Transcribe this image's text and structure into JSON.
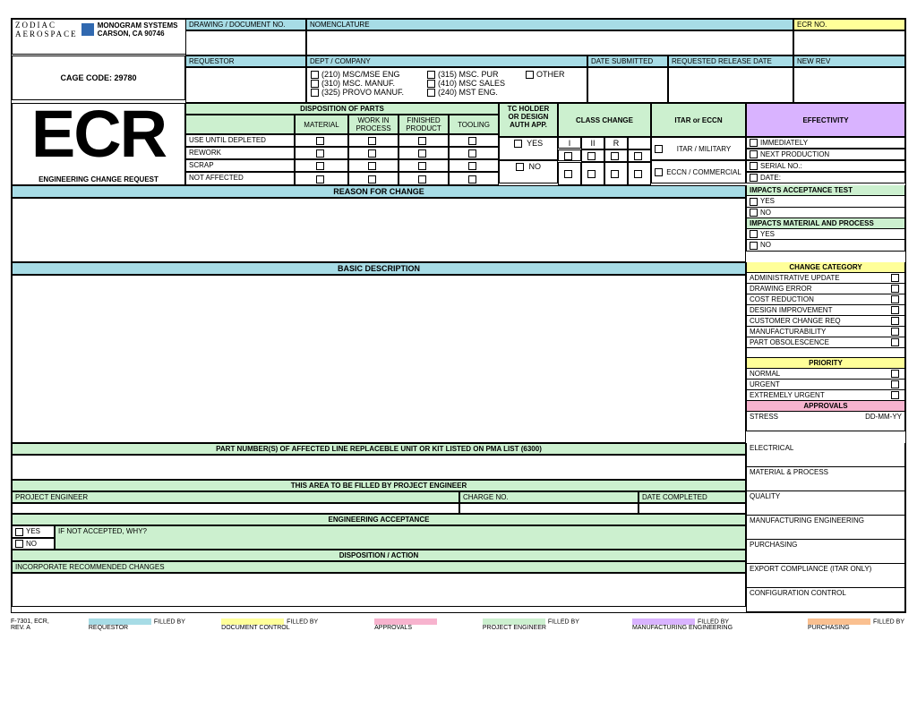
{
  "header": {
    "company_name": "MONOGRAM SYSTEMS",
    "company_city": "CARSON, CA 90746",
    "cage_label": "CAGE CODE:",
    "cage_code": "29780",
    "drawing_doc_label": "DRAWING / DOCUMENT NO.",
    "nomenclature_label": "NOMENCLATURE",
    "ecr_no_label": "ECR NO.",
    "requestor_label": "REQUESTOR",
    "dept_company_label": "DEPT / COMPANY",
    "date_submitted_label": "DATE SUBMITTED",
    "requested_release_label": "REQUESTED RELEASE DATE",
    "new_rev_label": "NEW REV",
    "departments": [
      "(210) MSC/MSE ENG",
      "(315) MSC. PUR",
      "OTHER",
      "(310) MSC. MANUF.",
      "(410) MSC SALES",
      "(325) PROVO MANUF.",
      "(240) MST ENG."
    ]
  },
  "ecr": {
    "title": "ECR",
    "subtitle": "ENGINEERING CHANGE REQUEST"
  },
  "disposition": {
    "section_label": "DISPOSITION OF PARTS",
    "cols": [
      "MATERIAL",
      "WORK IN PROCESS",
      "FINISHED PRODUCT",
      "TOOLING"
    ],
    "rows": [
      "USE UNTIL DEPLETED",
      "REWORK",
      "SCRAP",
      "NOT AFFECTED"
    ]
  },
  "tcholder": {
    "label": "TC HOLDER OR DESIGN AUTH APP.",
    "yes": "YES",
    "no": "NO"
  },
  "class_change": {
    "label": "CLASS CHANGE",
    "cols": [
      "I",
      "II",
      "R"
    ]
  },
  "itar": {
    "label": "ITAR or ECCN",
    "opt1": "ITAR / MILITARY",
    "opt2": "ECCN / COMMERCIAL"
  },
  "effectivity": {
    "label": "EFFECTIVITY",
    "rows": [
      "IMMEDIATELY",
      "NEXT PRODUCTION",
      "SERIAL NO.:",
      "DATE:"
    ]
  },
  "reason": "REASON FOR CHANGE",
  "impacts_acc": {
    "label": "IMPACTS ACCEPTANCE TEST",
    "yes": "YES",
    "no": "NO"
  },
  "impacts_mat": {
    "label": "IMPACTS MATERIAL AND PROCESS",
    "yes": "YES",
    "no": "NO"
  },
  "basic_desc": "BASIC DESCRIPTION",
  "change_cat": {
    "label": "CHANGE CATEGORY",
    "items": [
      "ADMINISTRATIVE UPDATE",
      "DRAWING ERROR",
      "COST REDUCTION",
      "DESIGN IMPROVEMENT",
      "CUSTOMER CHANGE REQ",
      "MANUFACTURABILITY",
      "PART OBSOLESCENCE"
    ]
  },
  "priority": {
    "label": "PRIORITY",
    "items": [
      "NORMAL",
      "URGENT",
      "EXTREMELY URGENT"
    ]
  },
  "pn_section": "PART NUMBER(S) OF AFFECTED LINE REPLACEBLE UNIT OR KIT LISTED ON PMA LIST  (6300)",
  "approvals": {
    "label": "APPROVALS",
    "stress": "STRESS",
    "date_fmt": "DD-MM-YY",
    "items": [
      "ELECTRICAL",
      "MATERIAL & PROCESS",
      "QUALITY",
      "MANUFACTURING ENGINEERING",
      "PURCHASING",
      "EXPORT COMPLIANCE (ITAR ONLY)",
      "CONFIGURATION CONTROL"
    ]
  },
  "pe_section": {
    "filled_by": "THIS AREA TO BE FILLED BY PROJECT ENGINEER",
    "pe_label": "PROJECT ENGINEER",
    "charge_label": "CHARGE NO.",
    "date_comp": "DATE COMPLETED",
    "eng_acc": "ENGINEERING ACCEPTANCE",
    "yes": "YES",
    "no": "NO",
    "not_accepted": "IF NOT ACCEPTED, WHY?",
    "disposition": "DISPOSITION / ACTION",
    "incorporate": "INCORPORATE RECOMMENDED CHANGES"
  },
  "footer": {
    "doc_id": "F-7301, ECR, REV. A",
    "legend": [
      "FILLED BY REQUESTOR",
      "FILLED BY DOCUMENT CONTROL",
      "APPROVALS",
      "FILLED BY PROJECT ENGINEER",
      "FILLED BY MANUFACTURING ENGINEERING",
      "FILLED BY PURCHASING"
    ]
  }
}
